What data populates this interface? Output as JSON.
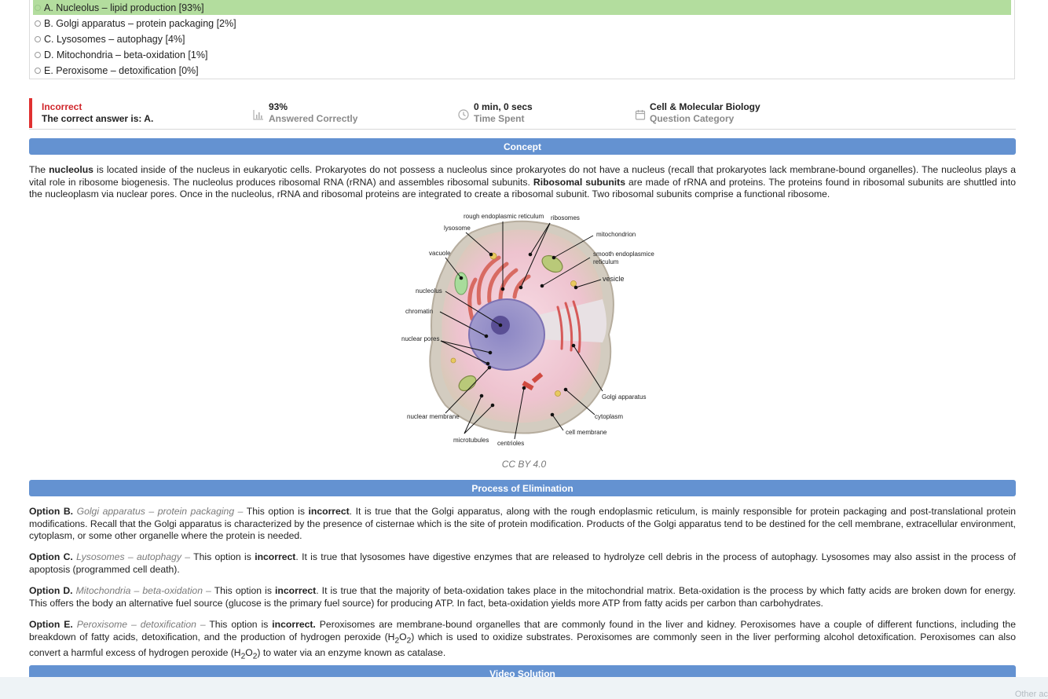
{
  "options": [
    {
      "label": "A. Nucleolus – lipid production [93%]",
      "selected": true
    },
    {
      "label": "B. Golgi apparatus – protein packaging [2%]",
      "selected": false
    },
    {
      "label": "C. Lysosomes – autophagy [4%]",
      "selected": false
    },
    {
      "label": "D. Mitochondria – beta-oxidation [1%]",
      "selected": false
    },
    {
      "label": "E. Peroxisome – detoxification [0%]",
      "selected": false
    }
  ],
  "result": {
    "status": "Incorrect",
    "correct_answer": "The correct answer is: A.",
    "answered_value": "93%",
    "answered_label": "Answered Correctly",
    "time_value": "0 min, 0 secs",
    "time_label": "Time Spent",
    "category_value": "Cell & Molecular Biology",
    "category_label": "Question Category"
  },
  "concept": {
    "heading": "Concept",
    "p1": "The ",
    "b1": "nucleolus",
    "p2": " is located inside of the nucleus in eukaryotic cells. Prokaryotes do not possess a nucleolus since prokaryotes do not have a nucleus (recall that prokaryotes lack membrane-bound organelles). The nucleolus plays a vital role in ribosome biogenesis. The nucleolus produces ribosomal RNA (rRNA) and assembles ribosomal subunits. ",
    "b2": "Ribosomal subunits",
    "p3": " are made of rRNA and proteins. The proteins found in ribosomal subunits are shuttled into the nucleoplasm via nuclear pores. Once in the nucleolus, rRNA and ribosomal proteins are integrated to create a ribosomal subunit. Two ribosomal subunits comprise a functional ribosome."
  },
  "diagram_labels": {
    "rer": "rough endoplasmic reticulum",
    "ribosomes": "ribosomes",
    "lysosome": "lysosome",
    "mitochondrion": "mitochondrion",
    "vacuole": "vacuole",
    "ser1": "smooth endoplasmice",
    "ser2": "reticulum",
    "vesicle": "vesicle",
    "nucleolus": "nucleolus",
    "chromatin": "chromatin",
    "nuclear_pores": "nuclear pores",
    "golgi": "Golgi apparatus",
    "cytoplasm": "cytoplasm",
    "nuclear_membrane": "nuclear membrane",
    "cell_membrane": "cell membrane",
    "microtubules": "microtubules",
    "centrioles": "centrioles"
  },
  "caption": "CC BY 4.0",
  "elimination": {
    "heading": "Process of Elimination",
    "items": [
      {
        "lead": "Option B.",
        "option": "Golgi apparatus – protein packaging –",
        "pre": " This option is ",
        "verdict": "incorrect",
        "text": ". It is true that the Golgi apparatus, along with the rough endoplasmic reticulum, is mainly responsible for protein packaging and post-translational protein modifications. Recall that the Golgi apparatus is characterized by the presence of cisternae which is the site of protein modification. Products of the Golgi apparatus tend to be destined for the cell membrane, extracellular environment, cytoplasm, or some other organelle where the protein is needed."
      },
      {
        "lead": "Option C.",
        "option": "Lysosomes – autophagy –",
        "pre": " This option is ",
        "verdict": "incorrect",
        "text": ". It is true that lysosomes have digestive enzymes that are released to hydrolyze cell debris in the process of autophagy.  Lysosomes may also assist in the process of apoptosis (programmed cell death)."
      },
      {
        "lead": "Option D.",
        "option": "Mitochondria – beta-oxidation –",
        "pre": " This option is ",
        "verdict": "incorrect",
        "text": ". It is true that the majority of beta-oxidation takes place in the mitochondrial matrix. Beta-oxidation is the process by which fatty acids are broken down for energy. This offers the body an alternative fuel source (glucose is the primary fuel source) for producing ATP. In fact, beta-oxidation yields more ATP from fatty acids per carbon than carbohydrates."
      }
    ],
    "e": {
      "lead": "Option E.",
      "option": "Peroxisome – detoxification –",
      "pre": " This option is ",
      "verdict": "incorrect.",
      "t1": "  Peroxisomes are membrane-bound organelles that are commonly found in the liver and kidney. Peroxisomes have a couple of different functions, including the breakdown of fatty acids, detoxification, and the production of hydrogen peroxide (H",
      "s1": "2",
      "t2": "O",
      "s2": "2",
      "t3": ") which is used to oxidize substrates. Peroxisomes are commonly seen in the liver performing alcohol detoxification. Peroxisomes can also convert a harmful excess of hydrogen peroxide (H",
      "s3": "2",
      "t4": "O",
      "s4": "2",
      "t5": ") to water via an enzyme known as catalase."
    }
  },
  "video": {
    "heading": "Video Solution"
  },
  "footer": {
    "text": "Other ac"
  }
}
